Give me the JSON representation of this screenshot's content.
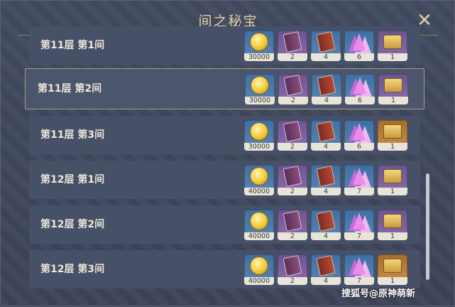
{
  "header": {
    "title": "间之秘宝"
  },
  "rows": [
    {
      "label": "第11层 第1间",
      "selected": false,
      "items": [
        {
          "icon": "gold-coin-icon",
          "bg": "blue",
          "count": "30000"
        },
        {
          "icon": "purple-book-icon",
          "bg": "purple",
          "count": "2"
        },
        {
          "icon": "red-book-icon",
          "bg": "blue",
          "count": "4"
        },
        {
          "icon": "crystal-icon",
          "bg": "blue",
          "count": "6"
        },
        {
          "icon": "chest-icon",
          "bg": "purple",
          "count": "1"
        }
      ]
    },
    {
      "label": "第11层 第2间",
      "selected": true,
      "items": [
        {
          "icon": "gold-coin-icon",
          "bg": "blue",
          "count": "30000"
        },
        {
          "icon": "purple-book-icon",
          "bg": "purple",
          "count": "2"
        },
        {
          "icon": "red-book-icon",
          "bg": "blue",
          "count": "4"
        },
        {
          "icon": "crystal-icon",
          "bg": "blue",
          "count": "6"
        },
        {
          "icon": "chest-icon",
          "bg": "purple",
          "count": "1"
        }
      ]
    },
    {
      "label": "第11层 第3间",
      "selected": false,
      "items": [
        {
          "icon": "gold-coin-icon",
          "bg": "blue",
          "count": "30000"
        },
        {
          "icon": "purple-book-icon",
          "bg": "purple",
          "count": "2"
        },
        {
          "icon": "red-book-icon",
          "bg": "blue",
          "count": "4"
        },
        {
          "icon": "crystal-icon",
          "bg": "blue",
          "count": "6"
        },
        {
          "icon": "chest-icon",
          "bg": "gold",
          "count": "1"
        }
      ]
    },
    {
      "label": "第12层 第1间",
      "selected": false,
      "items": [
        {
          "icon": "gold-coin-icon",
          "bg": "blue",
          "count": "40000"
        },
        {
          "icon": "purple-book-icon",
          "bg": "purple",
          "count": "2"
        },
        {
          "icon": "red-book-icon",
          "bg": "blue",
          "count": "4"
        },
        {
          "icon": "crystal-icon",
          "bg": "blue",
          "count": "7"
        },
        {
          "icon": "chest-icon",
          "bg": "purple",
          "count": "1"
        }
      ]
    },
    {
      "label": "第12层 第2间",
      "selected": false,
      "items": [
        {
          "icon": "gold-coin-icon",
          "bg": "blue",
          "count": "40000"
        },
        {
          "icon": "purple-book-icon",
          "bg": "purple",
          "count": "2"
        },
        {
          "icon": "red-book-icon",
          "bg": "blue",
          "count": "4"
        },
        {
          "icon": "crystal-icon",
          "bg": "blue",
          "count": "7"
        },
        {
          "icon": "chest-icon",
          "bg": "purple",
          "count": "1"
        }
      ]
    },
    {
      "label": "第12层 第3间",
      "selected": false,
      "items": [
        {
          "icon": "gold-coin-icon",
          "bg": "blue",
          "count": "40000"
        },
        {
          "icon": "purple-book-icon",
          "bg": "purple",
          "count": "2"
        },
        {
          "icon": "red-book-icon",
          "bg": "blue",
          "count": "4"
        },
        {
          "icon": "crystal-icon",
          "bg": "blue",
          "count": "7"
        },
        {
          "icon": "chest-icon",
          "bg": "gold",
          "count": "1"
        }
      ]
    }
  ],
  "watermark": "搜狐号@原神萌新"
}
